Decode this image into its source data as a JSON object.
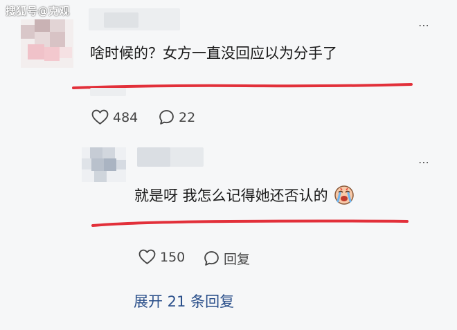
{
  "watermark": "搜狐号@克观",
  "comments": [
    {
      "text": "啥时候的？女方一直没回应以为分手了",
      "likes": "484",
      "replies": "22"
    },
    {
      "text": "就是呀 我怎么记得她还否认的",
      "likes": "150",
      "reply_label": "回复"
    }
  ],
  "expand_label": "展开 21 条回复",
  "colors": {
    "underline": "#e2303a",
    "link": "#2a4f8a",
    "background": "#f6f7f8"
  },
  "icons": [
    "more-icon",
    "heart-icon",
    "comment-icon",
    "crying-emoji-icon"
  ]
}
